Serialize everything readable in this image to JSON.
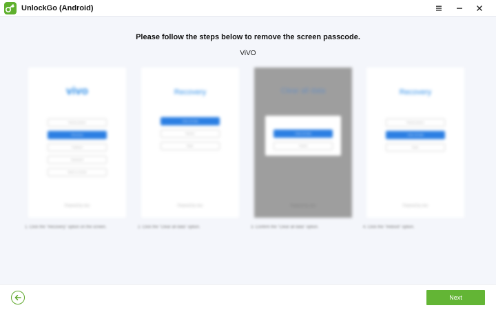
{
  "app": {
    "title": "UnlockGo (Android)"
  },
  "main": {
    "heading": "Please follow the steps below to remove the screen passcode.",
    "brand": "ViVO",
    "steps": [
      {
        "screen_title": "vivo",
        "options": [
          "Reboot phone",
          "Recovery",
          "Fastboot",
          "Advanced",
          "Back to normal"
        ],
        "footer": "Powered by vivo",
        "caption": "1. Click the \"Recovery\" option on the screen."
      },
      {
        "screen_title": "Recovery",
        "options": [
          "Clear all data",
          "Reboot",
          "Back"
        ],
        "footer": "Powered by vivo",
        "caption": "2. Click the \"Clear all data\" option."
      },
      {
        "screen_title": "Clear all data",
        "options": [
          "Clear all data",
          "Cancel"
        ],
        "footer": "Powered by vivo",
        "caption": "3. Confirm the \"Clear all data\" option."
      },
      {
        "screen_title": "Recovery",
        "options": [
          "Reboot phone",
          "Clear all data",
          "Back"
        ],
        "footer": "Powered by vivo",
        "caption": "4. Click the \"Reboot\" option."
      }
    ]
  },
  "footer": {
    "next_label": "Next"
  },
  "colors": {
    "accent": "#63b535",
    "link_blue": "#2b7fe3"
  },
  "icons": {
    "logo": "unlockgo-logo-icon",
    "menu": "menu-icon",
    "minimize": "minimize-icon",
    "close": "close-icon",
    "back": "back-arrow-icon"
  }
}
